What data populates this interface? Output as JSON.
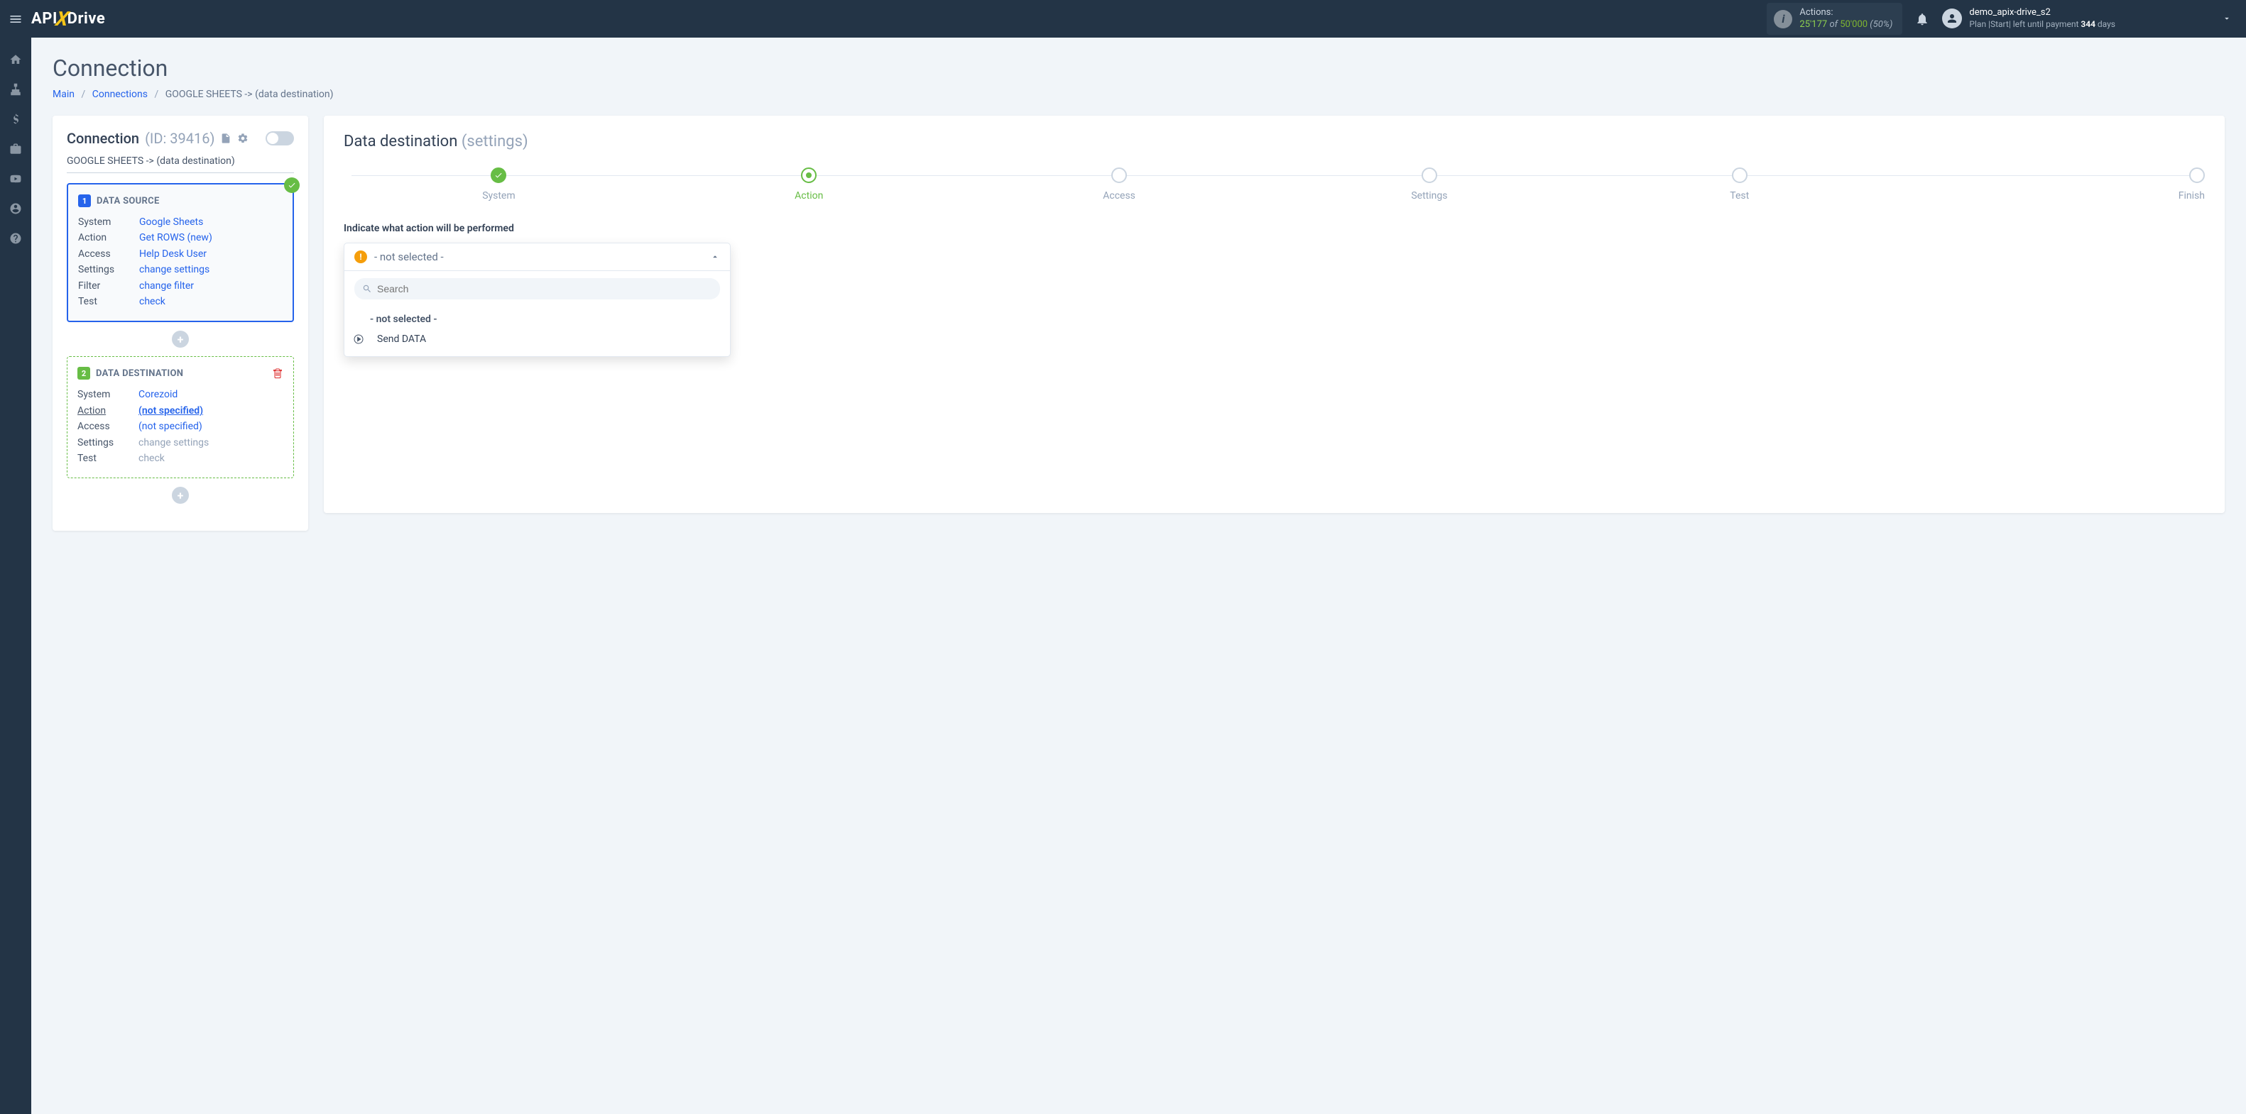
{
  "topbar": {
    "logo": {
      "api": "API",
      "x": "X",
      "drive": "Drive"
    },
    "actions": {
      "label": "Actions:",
      "used": "25'177",
      "of": "of",
      "total": "50'000",
      "pct": "(50%)"
    },
    "user": {
      "name": "demo_apix-drive_s2",
      "plan_prefix": "Plan |Start| left until payment ",
      "days": "344",
      "days_suffix": " days"
    }
  },
  "page": {
    "title": "Connection",
    "breadcrumb": {
      "main": "Main",
      "connections": "Connections",
      "current": "GOOGLE SHEETS -> (data destination)"
    }
  },
  "left": {
    "title": "Connection",
    "id": "(ID: 39416)",
    "subtitle": "GOOGLE SHEETS -> (data destination)",
    "source": {
      "badge": "1",
      "title": "DATA SOURCE",
      "rows": {
        "system_k": "System",
        "system_v": "Google Sheets",
        "action_k": "Action",
        "action_v": "Get ROWS (new)",
        "access_k": "Access",
        "access_v": "Help Desk User",
        "settings_k": "Settings",
        "settings_v": "change settings",
        "filter_k": "Filter",
        "filter_v": "change filter",
        "test_k": "Test",
        "test_v": "check"
      }
    },
    "dest": {
      "badge": "2",
      "title": "DATA DESTINATION",
      "rows": {
        "system_k": "System",
        "system_v": "Corezoid",
        "action_k": "Action",
        "action_v": "(not specified)",
        "access_k": "Access",
        "access_v": "(not specified)",
        "settings_k": "Settings",
        "settings_v": "change settings",
        "test_k": "Test",
        "test_v": "check"
      }
    }
  },
  "right": {
    "title": "Data destination",
    "subtitle": "(settings)",
    "steps": [
      "System",
      "Action",
      "Access",
      "Settings",
      "Test",
      "Finish"
    ],
    "form_label": "Indicate what action will be performed",
    "select": {
      "current": "- not selected -",
      "search_placeholder": "Search",
      "options": {
        "nosel": "- not selected -",
        "send": "Send DATA"
      }
    }
  }
}
